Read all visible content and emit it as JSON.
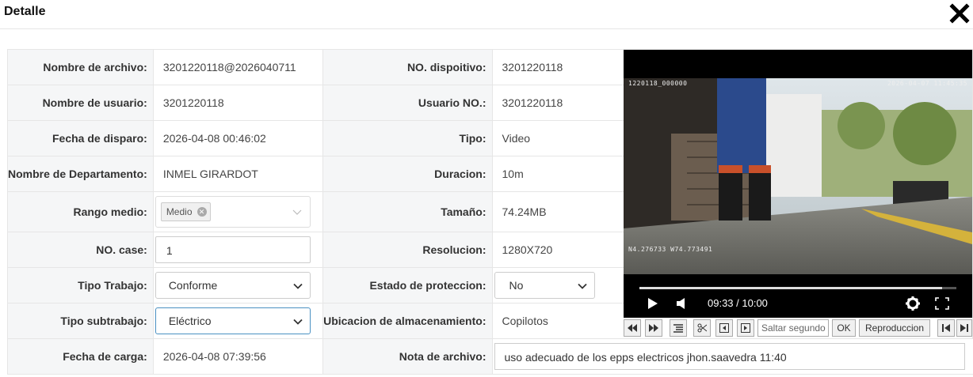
{
  "header": {
    "title": "Detalle"
  },
  "rows": [
    {
      "label1": "Nombre de archivo:",
      "value1": "3201220118@2026040711",
      "label2": "NO. dispoitivo:",
      "value2": "3201220118"
    },
    {
      "label1": "Nombre de usuario:",
      "value1": "3201220118",
      "label2": "Usuario NO.:",
      "value2": "3201220118"
    },
    {
      "label1": "Fecha de disparo:",
      "value1": "2026-04-08 00:46:02",
      "label2": "Tipo:",
      "value2": "Video"
    },
    {
      "label1": "Nombre de Departamento:",
      "value1": "INMEL GIRARDOT",
      "label2": "Duracion:",
      "value2": "10m"
    },
    {
      "label1": "Rango medio:",
      "value1": "Medio",
      "label2": "Tamaño:",
      "value2": "74.24MB"
    },
    {
      "label1": "NO. case:",
      "value1": "1",
      "label2": "Resolucion:",
      "value2": "1280X720"
    },
    {
      "label1": "Tipo Trabajo:",
      "value1": "Conforme",
      "label2": "Estado de proteccion:",
      "value2": "No"
    },
    {
      "label1": "Tipo subtrabajo:",
      "value1": "Eléctrico",
      "label2": "Ubicacion de almacenamiento:",
      "value2": "Copilotos"
    },
    {
      "label1": "Fecha de carga:",
      "value1": "2026-04-08 07:39:56",
      "label2": "Nota de archivo:",
      "value2": "uso adecuado de los epps electricos jhon.saavedra 11:40"
    }
  ],
  "video": {
    "osd_left": "1220118_000000",
    "osd_right": "2026-04-07 11:45:35",
    "osd_coords": "N4.276733  W74.773491",
    "time": "09:33 / 10:00",
    "progress": 0.955
  },
  "toolbar": {
    "skip_placeholder": "Saltar segundo",
    "ok_label": "OK",
    "play_label": "Reproduccion"
  },
  "colors": {
    "label_bg": "#f5f6f7",
    "border": "#e6e6e6",
    "focus": "#4a90c2"
  }
}
